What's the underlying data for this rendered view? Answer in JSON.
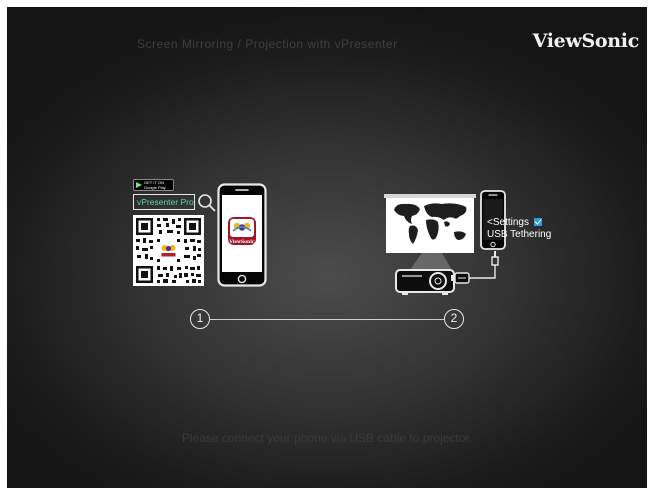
{
  "header": {
    "subtitle": "Screen Mirroring / Projection with vPresenter",
    "brand": "ViewSonic"
  },
  "step1": {
    "store_badge_small": "GET IT ON",
    "store_badge_name": "Google Play",
    "search_text": "vPresenter Pro",
    "app_icon_label": "ViewSonic",
    "number": "1"
  },
  "step2": {
    "settings_text": "<Settings",
    "tether_text": "USB Tethering",
    "number": "2"
  },
  "footer": {
    "instruction": "Please connect your phone via USB cable to projector."
  },
  "colors": {
    "accent_teal": "#5bd3b0",
    "check_blue": "#2a9dd8"
  }
}
